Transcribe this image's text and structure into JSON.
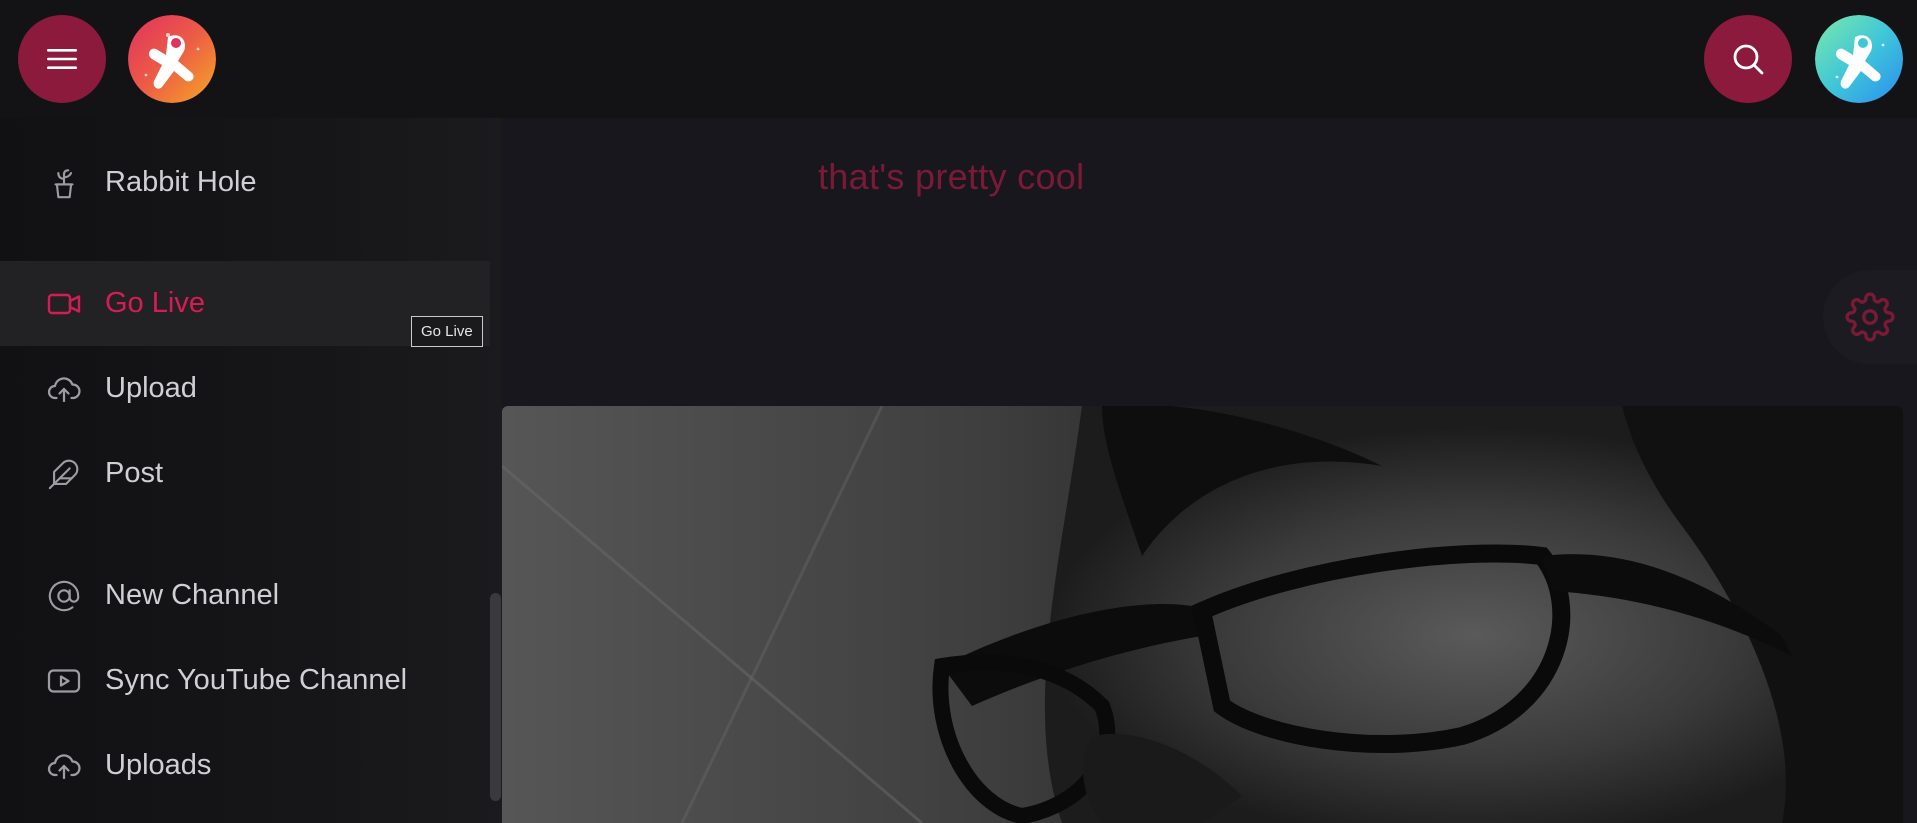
{
  "header": {
    "menu_icon": "hamburger-menu-icon",
    "logo_icon": "astronaut-logo",
    "search_icon": "search-icon",
    "profile_icon": "astronaut-avatar"
  },
  "sidebar": {
    "items": [
      {
        "label": "Rabbit Hole",
        "icon": "plant-pot-icon",
        "active": false
      },
      {
        "label": "Go Live",
        "icon": "video-camera-icon",
        "active": true
      },
      {
        "label": "Upload",
        "icon": "cloud-upload-icon",
        "active": false
      },
      {
        "label": "Post",
        "icon": "feather-icon",
        "active": false
      },
      {
        "label": "New Channel",
        "icon": "at-sign-icon",
        "active": false
      },
      {
        "label": "Sync YouTube Channel",
        "icon": "youtube-play-icon",
        "active": false
      },
      {
        "label": "Uploads",
        "icon": "cloud-upload-icon",
        "active": false
      }
    ],
    "tooltip": "Go Live"
  },
  "main": {
    "tagline": "that's pretty cool",
    "settings_icon": "gear-icon"
  },
  "colors": {
    "accent": "#8c1a3d",
    "active_text": "#d81b54",
    "background": "#131316",
    "tagline": "#7a1a36"
  }
}
